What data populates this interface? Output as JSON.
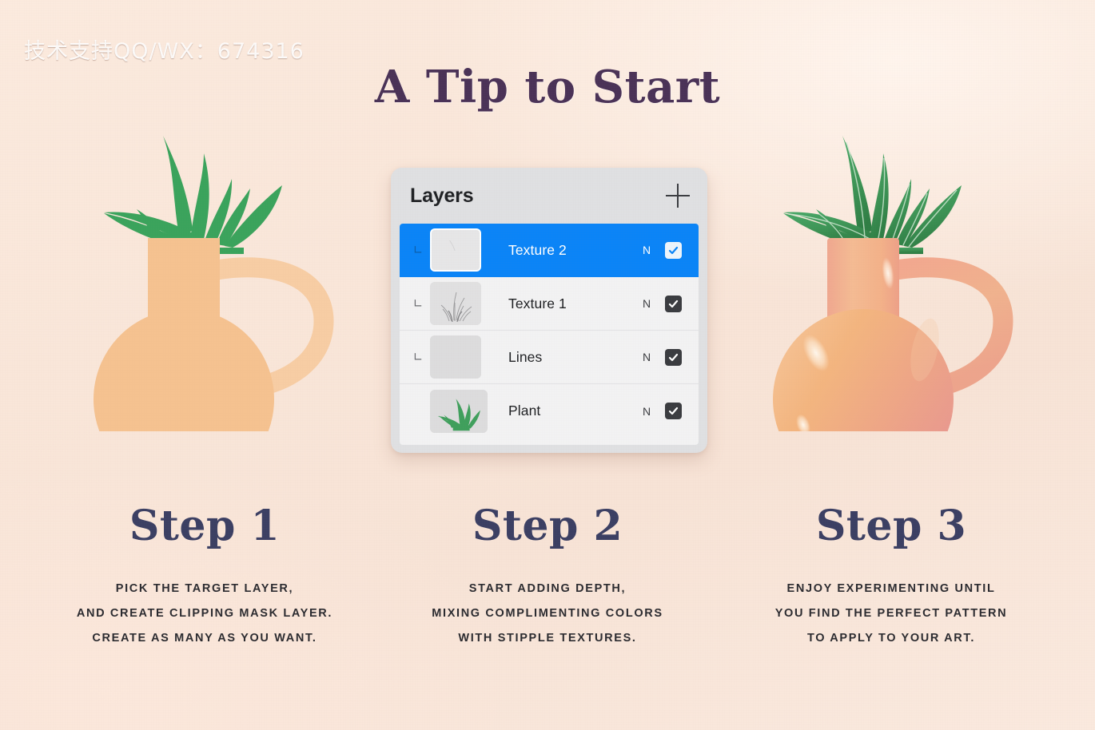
{
  "watermark": "技术支持QQ/WX：674316",
  "title": "A Tip to Start",
  "colors": {
    "background": "#f9e6d9",
    "title_purple": "#4a3257",
    "step_navy": "#3b3f63",
    "body_text": "#2b2b30",
    "selection_blue": "#0a84f7",
    "panel_grey": "#dfe0e2",
    "row_grey": "#f2f2f3",
    "checkbox_dark": "#3a3c40",
    "vase_flat_orange": "#f5c290",
    "vase_shaded_orange": "#f3b183",
    "vase_highlight_pink": "#f0a995",
    "plant_green": "#3aa35c"
  },
  "panel": {
    "title": "Layers",
    "add_button_label": "+",
    "layers": [
      {
        "name": "Texture 2",
        "blend_mode": "N",
        "visible": true,
        "selected": true,
        "clipped": true,
        "thumbnail": "blank-light"
      },
      {
        "name": "Texture 1",
        "blend_mode": "N",
        "visible": true,
        "selected": false,
        "clipped": true,
        "thumbnail": "sketch-grass"
      },
      {
        "name": "Lines",
        "blend_mode": "N",
        "visible": true,
        "selected": false,
        "clipped": true,
        "thumbnail": "blank-grey"
      },
      {
        "name": "Plant",
        "blend_mode": "N",
        "visible": true,
        "selected": false,
        "clipped": false,
        "thumbnail": "green-plant"
      }
    ]
  },
  "steps": [
    {
      "title": "Step 1",
      "lines": [
        "PICK THE TARGET LAYER,",
        "AND CREATE CLIPPING MASK LAYER.",
        "CREATE AS MANY AS YOU WANT."
      ]
    },
    {
      "title": "Step 2",
      "lines": [
        "START ADDING DEPTH,",
        "MIXING COMPLIMENTING COLORS",
        "WITH STIPPLE TEXTURES."
      ]
    },
    {
      "title": "Step 3",
      "lines": [
        "ENJOY EXPERIMENTING UNTIL",
        "YOU FIND THE PERFECT PATTERN",
        "TO APPLY TO YOUR ART."
      ]
    }
  ],
  "illustrations": {
    "left": {
      "label": "flat-color-vase-with-plant"
    },
    "right": {
      "label": "shaded-textured-vase-with-plant"
    }
  }
}
